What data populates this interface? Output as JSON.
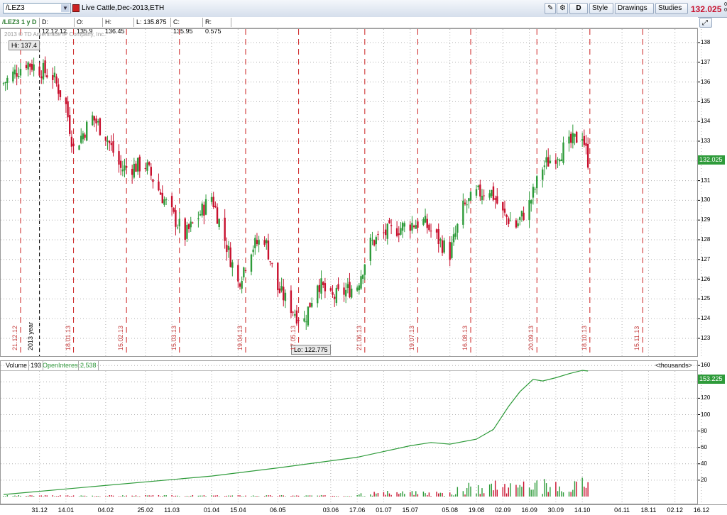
{
  "toolbar": {
    "symbol": "/LEZ3",
    "title": "Live Cattle,Dec-2013,ETH",
    "buttons": [
      "D",
      "Style",
      "Drawings",
      "Studies"
    ],
    "last_price": "132.025",
    "right_small": [
      "0",
      "0"
    ]
  },
  "infobar": {
    "segments": [
      "/LEZ3 1 y D",
      "D: 12.12.12",
      "O: 135.9",
      "H: 136.45",
      "L: 135.875",
      "C: 135.95",
      "R: 0.575"
    ]
  },
  "copyright": "2013 © TD Ameritrade IP Company, Inc.",
  "main": {
    "hi_label": "Hi: 137.4",
    "lo_label": "Lo: 122.775",
    "current_tag": "132.025",
    "year_marker": "2013 year",
    "y_ticks": [
      "138",
      "137",
      "136",
      "135",
      "134",
      "133",
      "132",
      "131",
      "130",
      "129",
      "128",
      "127",
      "126",
      "125",
      "124",
      "123",
      "122"
    ],
    "expiry_dates": [
      "21.12.12",
      "18.01.13",
      "15.02.13",
      "15.03.13",
      "19.04.13",
      "17.05.13",
      "21.06.13",
      "19.07.13",
      "16.08.13",
      "20.09.13",
      "18.10.13",
      "15.11.13"
    ]
  },
  "volume": {
    "label": "Volume",
    "volume_value": "193",
    "oi_label": "OpenInterest",
    "oi_value": "2,538",
    "units": "<thousands>",
    "current_tag": "153.225",
    "y_ticks": [
      "160",
      "140",
      "120",
      "100",
      "80",
      "60",
      "40",
      "20"
    ]
  },
  "x_axis": [
    "31.12",
    "14.01",
    "04.02",
    "25.02",
    "11.03",
    "01.04",
    "15.04",
    "06.05",
    "03.06",
    "17.06",
    "01.07",
    "15.07",
    "05.08",
    "19.08",
    "02.09",
    "16.09",
    "30.09",
    "14.10",
    "04.11",
    "18.11",
    "02.12",
    "16.12"
  ],
  "colors": {
    "up": "#2e9b3a",
    "down": "#c8102e",
    "grid": "#b0b0b0",
    "expiry": "#cc2222"
  },
  "chart_data": {
    "type": "candlestick",
    "title": "Live Cattle,Dec-2013,ETH",
    "ylim": [
      122,
      138.5
    ],
    "close_anchors": [
      {
        "date": "12.12.12",
        "close": 135.95
      },
      {
        "date": "24.12.12",
        "close": 137.0
      },
      {
        "date": "07.01.13",
        "close": 136.3
      },
      {
        "date": "14.01.13",
        "close": 134.8
      },
      {
        "date": "18.01.13",
        "close": 132.6
      },
      {
        "date": "28.01.13",
        "close": 134.2
      },
      {
        "date": "04.02.13",
        "close": 133.3
      },
      {
        "date": "12.02.13",
        "close": 131.6
      },
      {
        "date": "25.02.13",
        "close": 131.8
      },
      {
        "date": "11.03.13",
        "close": 129.3
      },
      {
        "date": "18.03.13",
        "close": 128.2
      },
      {
        "date": "01.04.13",
        "close": 130.2
      },
      {
        "date": "15.04.13",
        "close": 125.8
      },
      {
        "date": "22.04.13",
        "close": 127.6
      },
      {
        "date": "29.04.13",
        "close": 128.1
      },
      {
        "date": "06.05.13",
        "close": 125.5
      },
      {
        "date": "16.05.13",
        "close": 124.2
      },
      {
        "date": "20.05.13",
        "close": 123.9
      },
      {
        "date": "27.05.13",
        "close": 125.9
      },
      {
        "date": "03.06.13",
        "close": 125.0
      },
      {
        "date": "17.06.13",
        "close": 125.7
      },
      {
        "date": "24.06.13",
        "close": 127.8
      },
      {
        "date": "01.07.13",
        "close": 128.3
      },
      {
        "date": "15.07.13",
        "close": 128.8
      },
      {
        "date": "22.07.13",
        "close": 128.9
      },
      {
        "date": "05.08.13",
        "close": 127.3
      },
      {
        "date": "12.08.13",
        "close": 129.6
      },
      {
        "date": "19.08.13",
        "close": 130.3
      },
      {
        "date": "26.08.13",
        "close": 130.6
      },
      {
        "date": "02.09.13",
        "close": 129.3
      },
      {
        "date": "09.09.13",
        "close": 128.7
      },
      {
        "date": "16.09.13",
        "close": 129.8
      },
      {
        "date": "23.09.13",
        "close": 131.7
      },
      {
        "date": "30.09.13",
        "close": 132.3
      },
      {
        "date": "07.10.13",
        "close": 132.8
      },
      {
        "date": "14.10.13",
        "close": 133.4
      },
      {
        "date": "17.10.13",
        "close": 132.025
      }
    ],
    "open_interest": {
      "ylim": [
        0,
        160
      ],
      "points": [
        {
          "date": "12.12.12",
          "value": 2.5
        },
        {
          "date": "01.04.13",
          "value": 25
        },
        {
          "date": "06.05.13",
          "value": 35
        },
        {
          "date": "17.06.13",
          "value": 48
        },
        {
          "date": "15.07.13",
          "value": 62
        },
        {
          "date": "26.07.13",
          "value": 66
        },
        {
          "date": "05.08.13",
          "value": 64
        },
        {
          "date": "19.08.13",
          "value": 70
        },
        {
          "date": "28.08.13",
          "value": 82
        },
        {
          "date": "05.09.13",
          "value": 110
        },
        {
          "date": "11.09.13",
          "value": 128
        },
        {
          "date": "18.09.13",
          "value": 143
        },
        {
          "date": "23.09.13",
          "value": 141
        },
        {
          "date": "30.09.13",
          "value": 145
        },
        {
          "date": "07.10.13",
          "value": 150
        },
        {
          "date": "14.10.13",
          "value": 154
        },
        {
          "date": "17.10.13",
          "value": 153.225
        }
      ]
    }
  }
}
